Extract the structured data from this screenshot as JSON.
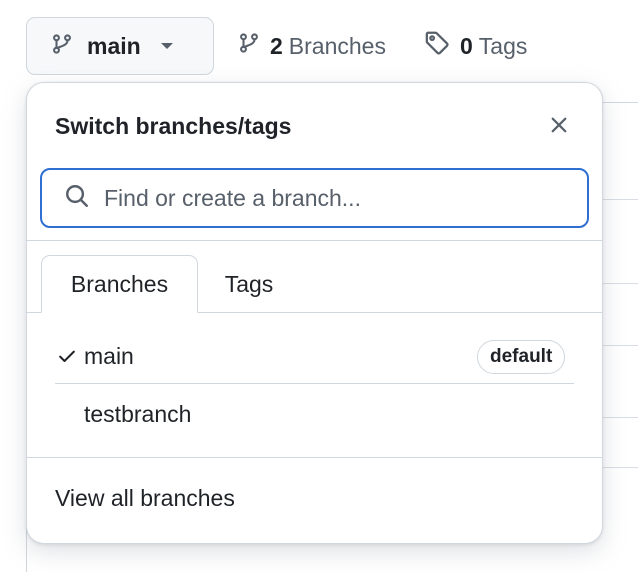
{
  "toolbar": {
    "branch_button_label": "main",
    "branches_count": "2",
    "branches_label": "Branches",
    "tags_count": "0",
    "tags_label": "Tags"
  },
  "dropdown": {
    "title": "Switch branches/tags",
    "search_placeholder": "Find or create a branch...",
    "tabs": [
      {
        "label": "Branches",
        "active": true
      },
      {
        "label": "Tags",
        "active": false
      }
    ],
    "branches": [
      {
        "name": "main",
        "selected": true,
        "badge": "default"
      },
      {
        "name": "testbranch",
        "selected": false,
        "badge": ""
      }
    ],
    "view_all_label": "View all branches"
  },
  "icons": {
    "branch": "git-branch-icon",
    "tag": "tag-icon",
    "search": "search-icon",
    "close": "close-icon",
    "check": "check-icon",
    "caret": "caret-down-icon"
  },
  "colors": {
    "focus_border": "#2f6fd1",
    "border": "#d0d7de",
    "muted_text": "#57606a",
    "text": "#1f2328"
  }
}
